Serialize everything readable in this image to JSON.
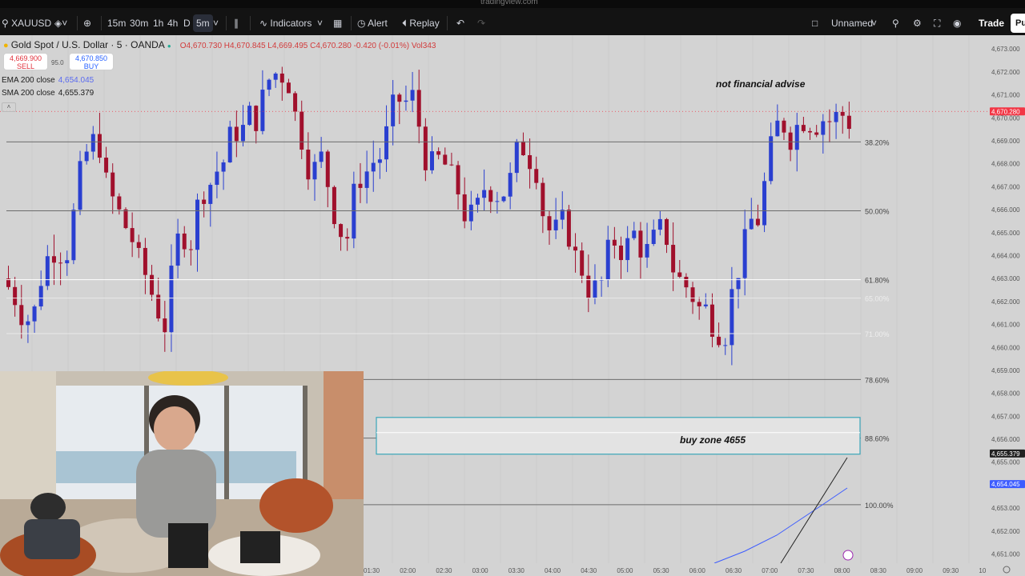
{
  "browser_url": "tradingview.com",
  "toolbar": {
    "symbol": "XAUUSD",
    "intervals": [
      "15m",
      "30m",
      "1h",
      "4h",
      "D",
      "5m"
    ],
    "active_interval": "5m",
    "indicators_label": "Indicators",
    "alert_label": "Alert",
    "replay_label": "Replay",
    "layout_name": "Unnamed",
    "trade_label": "Trade",
    "publish_label": "Pu"
  },
  "legend": {
    "title": "Gold Spot / U.S. Dollar · 5 · OANDA",
    "ohlc": "O4,670.730  H4,670.845  L4,669.495  C4,670.280  -0.420 (-0.01%)  Vol343",
    "sell_price": "4,669.900",
    "sell_label": "SELL",
    "spread": "95.0",
    "buy_price": "4,670.850",
    "buy_label": "BUY",
    "ema_label": "EMA 200 close",
    "ema_value": "4,654.045",
    "sma_label": "SMA 200 close",
    "sma_value": "4,655.379"
  },
  "annotations": {
    "top_note": "not financial advise",
    "zone_label": "buy zone 4655"
  },
  "colors": {
    "up_candle": "#2a3fd0",
    "down_candle": "#a0102c",
    "chart_bg": "#d3d3d3",
    "zone_border": "#3aa6b9",
    "ema_line": "#3d5cff",
    "current_price_tag": "#f23645"
  },
  "chart_data": {
    "type": "candlestick",
    "symbol": "XAUUSD",
    "ylim": [
      4650.6,
      4673.6
    ],
    "price_labels": [
      "4,673.000",
      "4,672.000",
      "4,671.000",
      "4,670.000",
      "4,669.000",
      "4,668.000",
      "4,667.000",
      "4,666.000",
      "4,665.000",
      "4,664.000",
      "4,663.000",
      "4,662.000",
      "4,661.000",
      "4,660.000",
      "4,659.000",
      "4,658.000",
      "4,657.000",
      "4,656.000",
      "4,655.000",
      "4,654.000",
      "4,653.000",
      "4,652.000",
      "4,651.000"
    ],
    "time_labels": [
      "01:30",
      "02:00",
      "02:30",
      "03:00",
      "03:30",
      "04:00",
      "04:30",
      "05:00",
      "05:30",
      "06:00",
      "06:30",
      "07:00",
      "07:30",
      "08:00",
      "08:30",
      "09:00",
      "09:30",
      "10"
    ],
    "current_price": "4,670.280",
    "sma_tag": "4,655.379",
    "ema_tag": "4,654.045",
    "fib_levels": [
      {
        "label": "38.20%",
        "price": 4668.95,
        "faded": false
      },
      {
        "label": "50.00%",
        "price": 4665.95,
        "faded": false
      },
      {
        "label": "61.80%",
        "price": 4662.95,
        "faded": false
      },
      {
        "label": "65.00%",
        "price": 4662.15,
        "faded": true
      },
      {
        "label": "71.00%",
        "price": 4660.6,
        "faded": true
      },
      {
        "label": "78.60%",
        "price": 4658.6,
        "faded": false
      },
      {
        "label": "88.60%",
        "price": 4656.05,
        "faded": false
      },
      {
        "label": "100.00%",
        "price": 4653.15,
        "faded": false
      }
    ],
    "zone": {
      "top": 4656.95,
      "bottom": 4655.35,
      "label": "buy zone 4655"
    }
  }
}
